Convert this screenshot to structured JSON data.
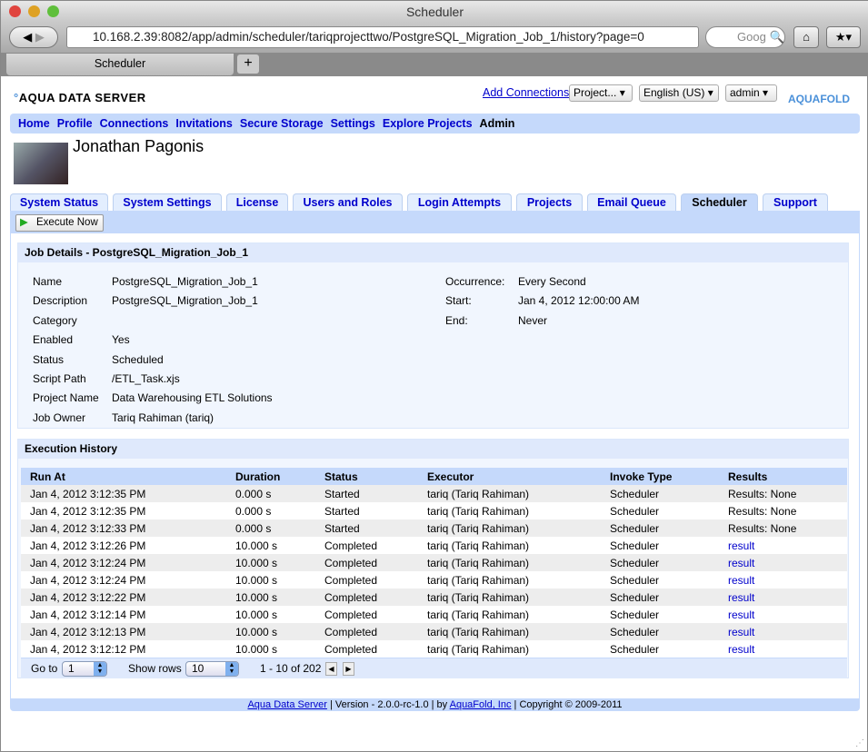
{
  "browser": {
    "title": "Scheduler",
    "url": "10.168.2.39:8082/app/admin/scheduler/tariqprojecttwo/PostgreSQL_Migration_Job_1/history?page=0",
    "search_placeholder": "Goog",
    "tab_label": "Scheduler",
    "new_tab": "+"
  },
  "header": {
    "logo": "AQUA DATA SERVER",
    "logo_right": "AQUAFOLD",
    "add_connections": "Add Connections",
    "project_select": "Project...",
    "language_select": "English (US)",
    "user_select": "admin"
  },
  "nav": [
    "Home",
    "Profile",
    "Connections",
    "Invitations",
    "Secure Storage",
    "Settings",
    "Explore Projects",
    "Admin"
  ],
  "user": {
    "name": "Jonathan Pagonis"
  },
  "admin_tabs": [
    "System Status",
    "System Settings",
    "License",
    "Users and Roles",
    "Login Attempts",
    "Projects",
    "Email Queue",
    "Scheduler",
    "Support"
  ],
  "active_tab": "Scheduler",
  "execute_now": "Execute Now",
  "job": {
    "title": "Job Details - PostgreSQL_Migration_Job_1",
    "left": [
      [
        "Name",
        "PostgreSQL_Migration_Job_1"
      ],
      [
        "Description",
        "PostgreSQL_Migration_Job_1"
      ],
      [
        "Category",
        ""
      ],
      [
        "Enabled",
        "Yes"
      ],
      [
        "Status",
        "Scheduled"
      ],
      [
        "Script Path",
        "/ETL_Task.xjs"
      ],
      [
        "Project Name",
        "Data Warehousing ETL Solutions"
      ],
      [
        "Job Owner",
        "Tariq Rahiman (tariq)"
      ]
    ],
    "right": [
      [
        "Occurrence:",
        "Every Second"
      ],
      [
        "Start:",
        "Jan 4, 2012 12:00:00 AM"
      ],
      [
        "End:",
        "Never"
      ]
    ]
  },
  "history": {
    "title": "Execution History",
    "columns": [
      "Run At",
      "Duration",
      "Status",
      "Executor",
      "Invoke Type",
      "Results"
    ],
    "rows": [
      [
        "Jan 4, 2012 3:12:35 PM",
        "0.000 s",
        "Started",
        "tariq (Tariq Rahiman)",
        "Scheduler",
        "Results: None"
      ],
      [
        "Jan 4, 2012 3:12:35 PM",
        "0.000 s",
        "Started",
        "tariq (Tariq Rahiman)",
        "Scheduler",
        "Results: None"
      ],
      [
        "Jan 4, 2012 3:12:33 PM",
        "0.000 s",
        "Started",
        "tariq (Tariq Rahiman)",
        "Scheduler",
        "Results: None"
      ],
      [
        "Jan 4, 2012 3:12:26 PM",
        "10.000 s",
        "Completed",
        "tariq (Tariq Rahiman)",
        "Scheduler",
        "result"
      ],
      [
        "Jan 4, 2012 3:12:24 PM",
        "10.000 s",
        "Completed",
        "tariq (Tariq Rahiman)",
        "Scheduler",
        "result"
      ],
      [
        "Jan 4, 2012 3:12:24 PM",
        "10.000 s",
        "Completed",
        "tariq (Tariq Rahiman)",
        "Scheduler",
        "result"
      ],
      [
        "Jan 4, 2012 3:12:22 PM",
        "10.000 s",
        "Completed",
        "tariq (Tariq Rahiman)",
        "Scheduler",
        "result"
      ],
      [
        "Jan 4, 2012 3:12:14 PM",
        "10.000 s",
        "Completed",
        "tariq (Tariq Rahiman)",
        "Scheduler",
        "result"
      ],
      [
        "Jan 4, 2012 3:12:13 PM",
        "10.000 s",
        "Completed",
        "tariq (Tariq Rahiman)",
        "Scheduler",
        "result"
      ],
      [
        "Jan 4, 2012 3:12:12 PM",
        "10.000 s",
        "Completed",
        "tariq (Tariq Rahiman)",
        "Scheduler",
        "result"
      ]
    ],
    "pager": {
      "goto_label": "Go to",
      "goto_value": "1",
      "rows_label": "Show rows",
      "rows_value": "10",
      "range": "1 - 10 of 202"
    }
  },
  "footer": {
    "link1": "Aqua Data Server",
    "text1": " | Version - 2.0.0-rc-1.0 | by ",
    "link2": "AquaFold, Inc",
    "text2": " | Copyright © 2009-2011"
  }
}
